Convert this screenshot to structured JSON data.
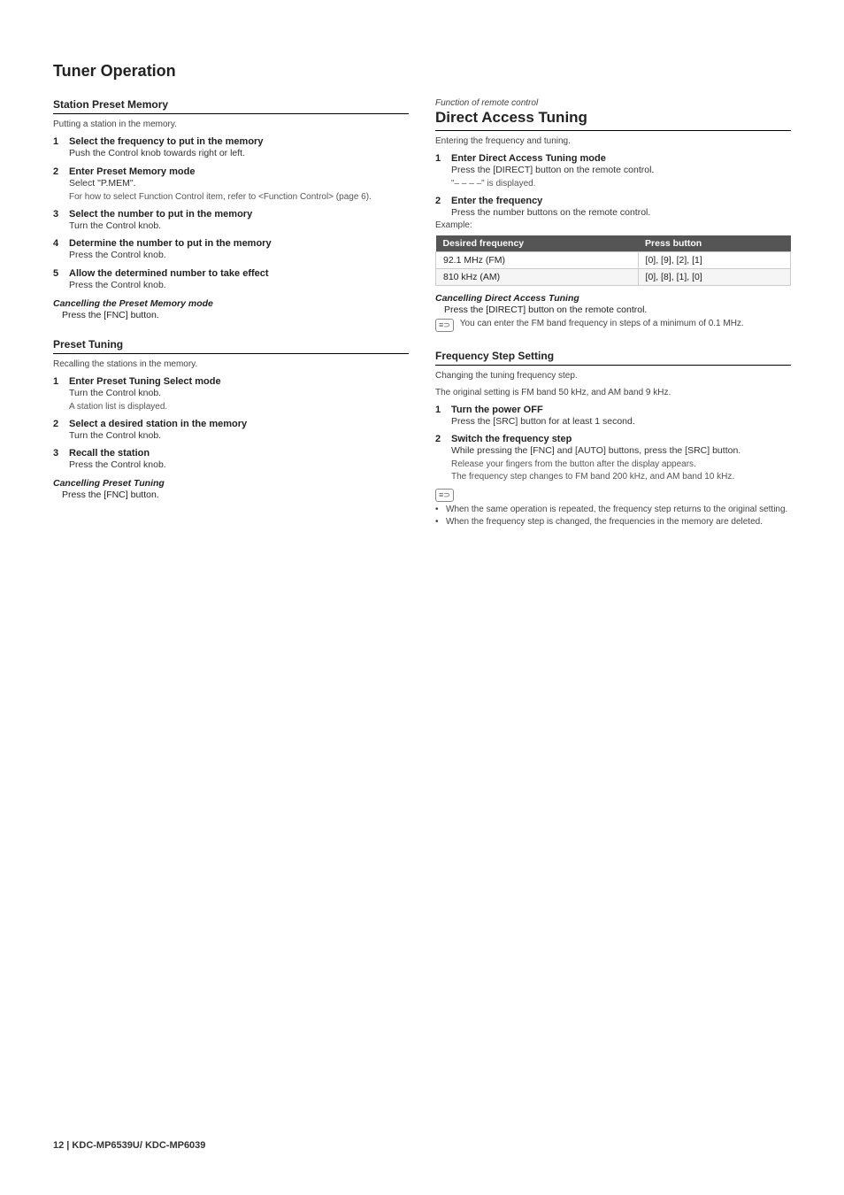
{
  "page": {
    "title": "Tuner Operation",
    "footer": "12  |  KDC-MP6539U/ KDC-MP6039"
  },
  "station_preset_memory": {
    "section_title": "Station Preset Memory",
    "subtitle": "Putting a station in the memory.",
    "steps": [
      {
        "number": "1",
        "header": "Select the frequency to put in the memory",
        "body": "Push the Control knob towards right or left."
      },
      {
        "number": "2",
        "header": "Enter Preset Memory mode",
        "body": "Select \"P.MEM\".",
        "subtext": "For how to select Function Control item, refer to <Function Control> (page 6)."
      },
      {
        "number": "3",
        "header": "Select the number to put in the memory",
        "body": "Turn the Control knob."
      },
      {
        "number": "4",
        "header": "Determine the number to put in the memory",
        "body": "Press the Control knob."
      },
      {
        "number": "5",
        "header": "Allow the determined number to take effect",
        "body": "Press the Control knob."
      }
    ],
    "cancel": {
      "header": "Cancelling the Preset Memory mode",
      "body": "Press the [FNC] button."
    }
  },
  "preset_tuning": {
    "section_title": "Preset Tuning",
    "subtitle": "Recalling the stations in the memory.",
    "steps": [
      {
        "number": "1",
        "header": "Enter Preset Tuning Select mode",
        "body": "Turn the Control knob.",
        "subtext": "A station list is displayed."
      },
      {
        "number": "2",
        "header": "Select a desired station in the memory",
        "body": "Turn the Control knob."
      },
      {
        "number": "3",
        "header": "Recall the station",
        "body": "Press the Control knob."
      }
    ],
    "cancel": {
      "header": "Cancelling Preset Tuning",
      "body": "Press the [FNC] button."
    }
  },
  "direct_access_tuning": {
    "function_label": "Function of remote control",
    "section_title": "Direct Access Tuning",
    "subtitle": "Entering the frequency and tuning.",
    "steps": [
      {
        "number": "1",
        "header": "Enter Direct Access Tuning mode",
        "body": "Press the [DIRECT] button on the remote control.",
        "subtext": "\"– – – –\" is displayed."
      },
      {
        "number": "2",
        "header": "Enter the frequency",
        "body": "Press the number buttons on the remote control.",
        "example_label": "Example:"
      }
    ],
    "table": {
      "headers": [
        "Desired frequency",
        "Press button"
      ],
      "rows": [
        [
          "92.1 MHz (FM)",
          "[0], [9], [2], [1]"
        ],
        [
          "810 kHz (AM)",
          "[0], [8], [1], [0]"
        ]
      ]
    },
    "cancel": {
      "header": "Cancelling Direct Access Tuning",
      "body": "Press the [DIRECT] button on the remote control."
    },
    "note_icon": "≡⊃",
    "note_text": "You can enter the FM band frequency in steps of a minimum of 0.1 MHz."
  },
  "frequency_step_setting": {
    "section_title": "Frequency Step Setting",
    "subtitle1": "Changing the tuning frequency step.",
    "subtitle2": "The original setting is FM band 50 kHz, and AM band 9 kHz.",
    "steps": [
      {
        "number": "1",
        "header": "Turn the power OFF",
        "body": "Press the [SRC] button for at least 1 second."
      },
      {
        "number": "2",
        "header": "Switch the frequency step",
        "body": "While pressing the [FNC] and [AUTO] buttons, press the [SRC] button.",
        "subtext1": "Release your fingers from the button after the display appears.",
        "subtext2": "The frequency step changes to FM band 200 kHz, and AM band 10 kHz."
      }
    ],
    "note_icon": "≡⊃",
    "bullets": [
      "When the same operation is repeated, the frequency step returns to the original setting.",
      "When the frequency step is changed, the frequencies in the memory are deleted."
    ]
  }
}
